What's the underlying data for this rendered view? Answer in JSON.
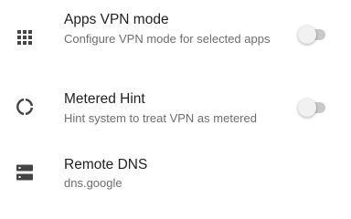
{
  "settings": [
    {
      "title": "Apps VPN mode",
      "summary": "Configure VPN mode for selected apps",
      "icon": "apps-grid-icon",
      "toggle": false
    },
    {
      "title": "Metered Hint",
      "summary": "Hint system to treat VPN as metered",
      "icon": "data-usage-icon",
      "toggle": false
    },
    {
      "title": "Remote DNS",
      "summary": "dns.google",
      "icon": "dns-server-icon"
    }
  ],
  "colors": {
    "title": "#212121",
    "summary": "#6d6d6d",
    "icon": "#444444",
    "switch_track_off": "#c9c9c9",
    "switch_thumb_off": "#f1f1f1"
  }
}
